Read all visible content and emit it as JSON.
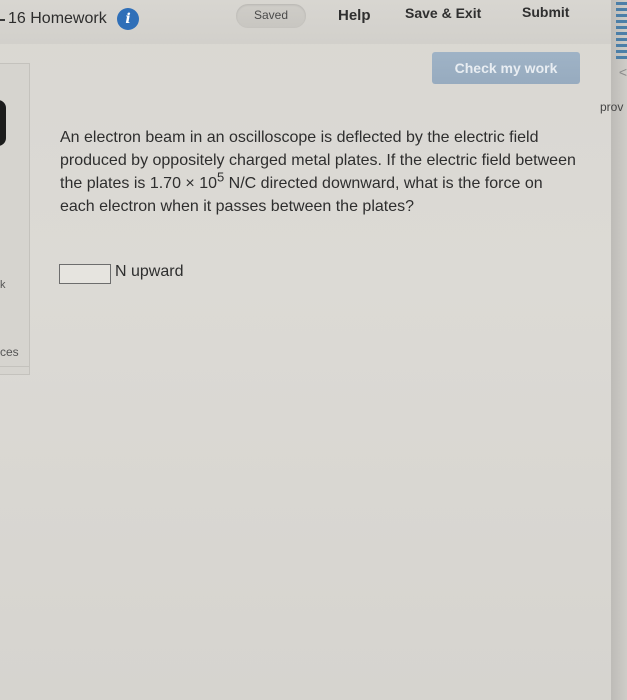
{
  "header": {
    "assignment_title": "16 Homework",
    "info_icon": "i",
    "saved_status": "Saved",
    "help_label": "Help",
    "save_exit_label": "Save & Exit",
    "submit_label": "Submit"
  },
  "toolbar": {
    "check_my_work_label": "Check my work"
  },
  "sidebar": {
    "partial_item_1": "k",
    "partial_item_2": "ces",
    "right_partial_label": "prov",
    "right_chevron": "<"
  },
  "question": {
    "text_before": "An electron beam in an oscilloscope is deflected by the electric field produced by oppositely charged metal plates. If the electric field between the plates is 1.70 × 10",
    "exponent": "5",
    "text_after": " N/C directed downward, what is the force on each electron when it passes between the plates?"
  },
  "answer": {
    "value": "",
    "unit": "N upward"
  },
  "colors": {
    "info_icon": "#2f6fb8",
    "check_button": "#9fb3c6",
    "page_background": "#d9d7d2"
  }
}
